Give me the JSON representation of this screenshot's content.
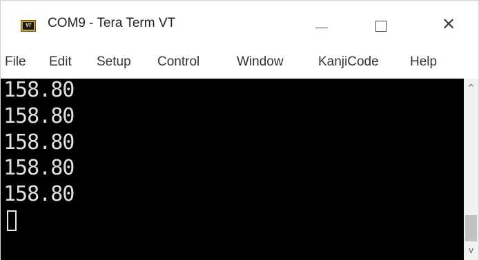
{
  "window": {
    "title": "COM9 - Tera Term VT",
    "icon_label": "VT",
    "icon_name": "tera-term-icon"
  },
  "title_buttons": {
    "minimize": "minimize-icon",
    "maximize": "maximize-icon",
    "close": "close-icon",
    "close_glyph": "✕"
  },
  "menu": {
    "items": [
      "File",
      "Edit",
      "Setup",
      "Control",
      "Window",
      "KanjiCode",
      "Help"
    ]
  },
  "terminal": {
    "lines": [
      "158.80",
      "158.80",
      "158.80",
      "158.80",
      "158.80"
    ],
    "background": "#000000",
    "foreground": "#e0e0e0"
  },
  "scrollbar": {
    "up_glyph": "^",
    "down_glyph": "v"
  }
}
